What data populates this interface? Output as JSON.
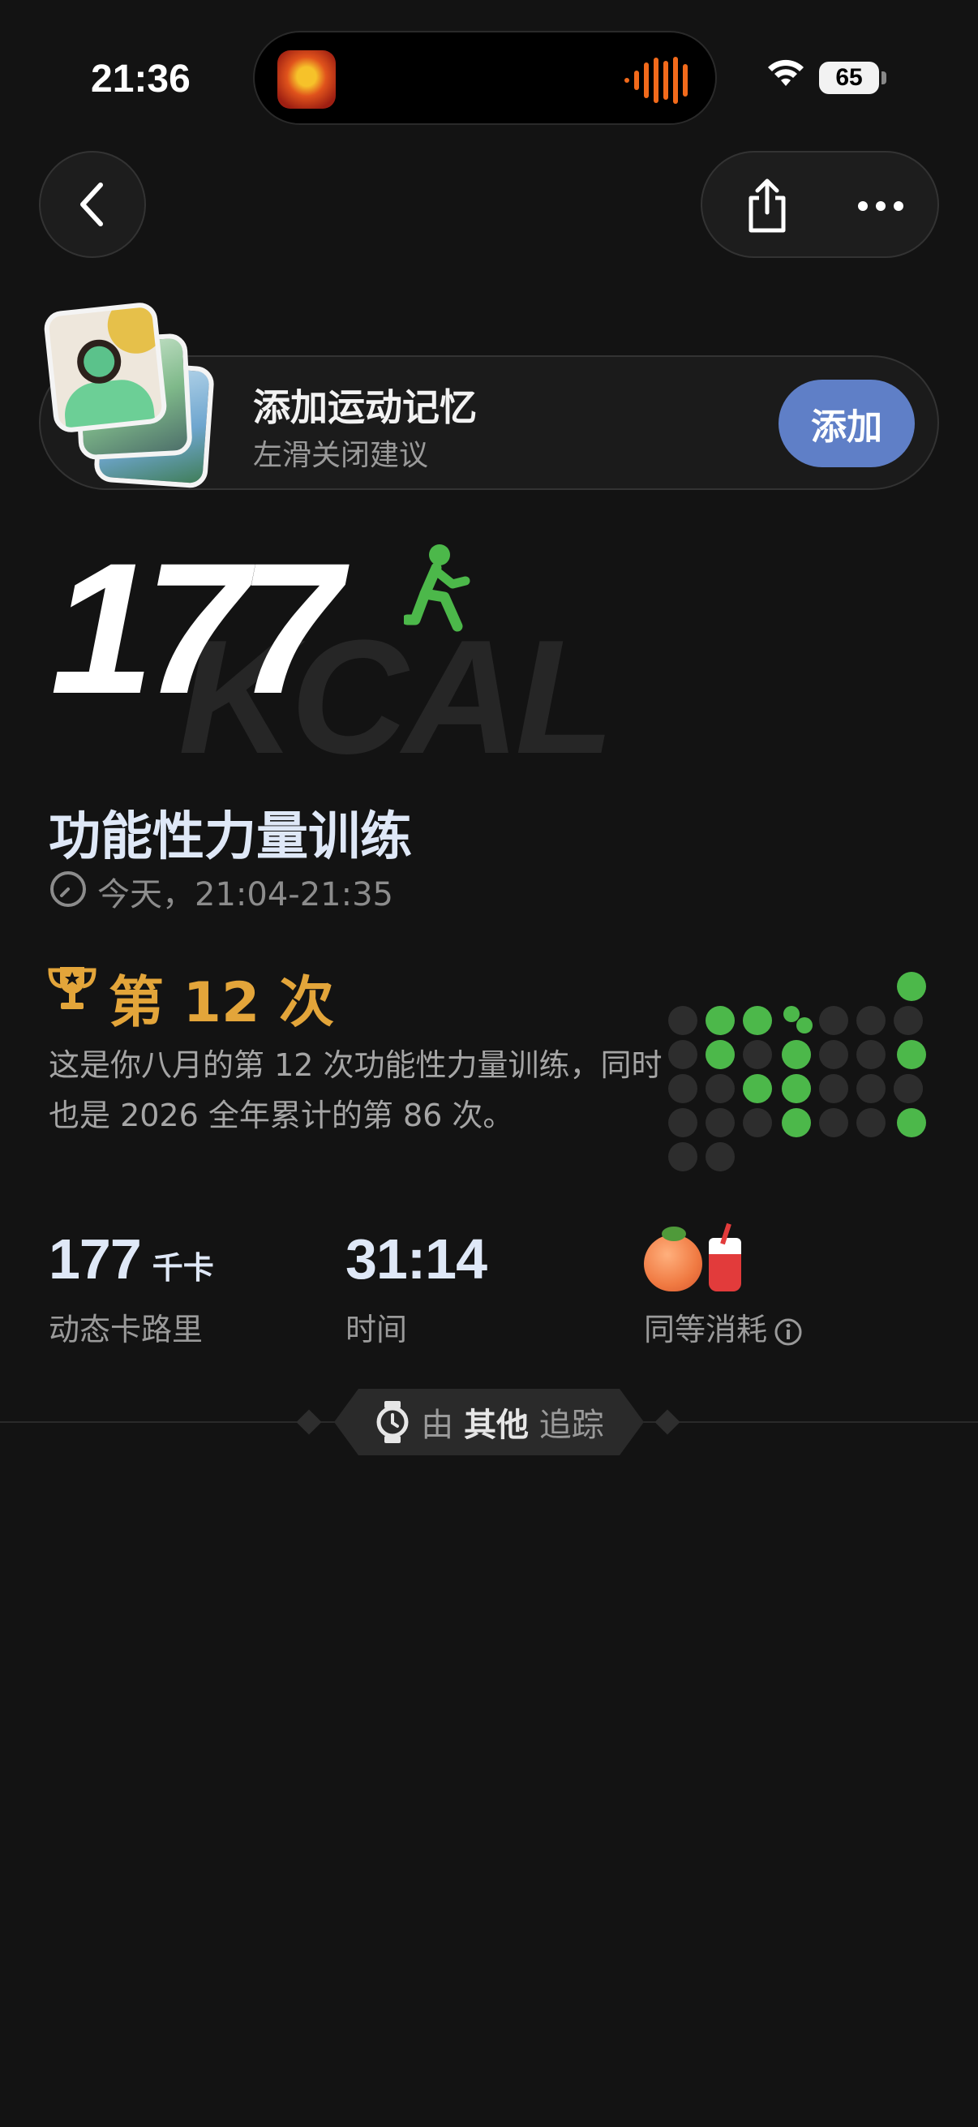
{
  "status_bar": {
    "time": "21:36",
    "battery": "65"
  },
  "memory_banner": {
    "title": "添加运动记忆",
    "subtitle": "左滑关闭建议",
    "add_label": "添加"
  },
  "hero": {
    "calories": "177",
    "unit_watermark": "KCAL"
  },
  "workout": {
    "title": "功能性力量训练",
    "time_range": "今天，21:04-21:35"
  },
  "rank": {
    "label": "第 12 次",
    "description": "这是你八月的第 12 次功能性力量训练，同时也是 2026 全年累计的第 86 次。"
  },
  "stats": {
    "calories_value": "177",
    "calories_unit": "千卡",
    "calories_label": "动态卡路里",
    "duration_value": "31:14",
    "duration_label": "时间",
    "equivalent_label": "同等消耗"
  },
  "tracker": {
    "prefix": "由",
    "source": "其他",
    "suffix": "追踪"
  },
  "colors": {
    "accent_green": "#4cb84a",
    "rank_gold": "#e3a53a",
    "add_button": "#5f7fc7",
    "background": "#131313"
  }
}
